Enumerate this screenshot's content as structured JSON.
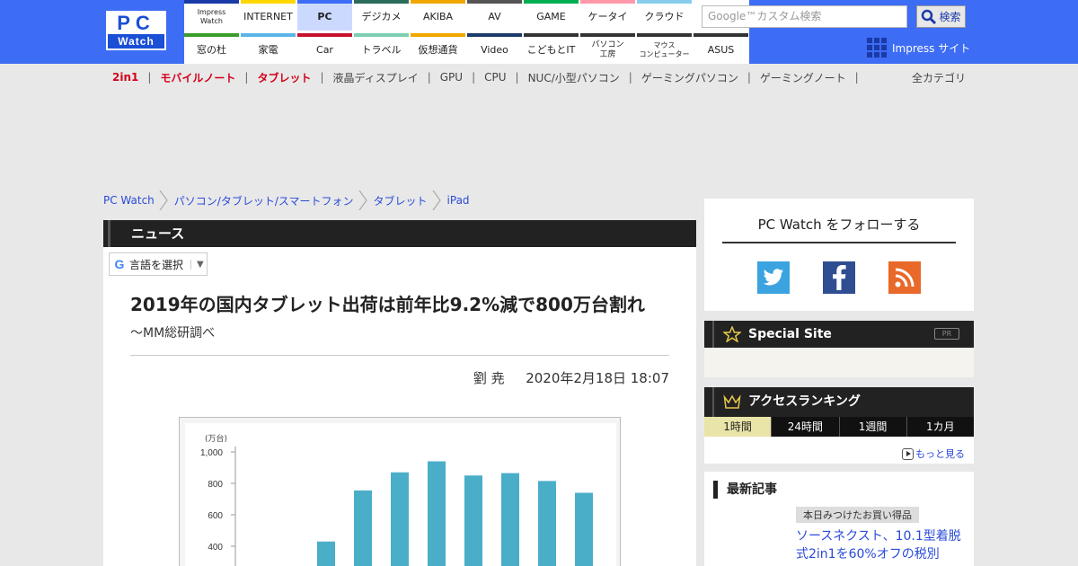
{
  "header": {
    "logo_top": "PC",
    "logo_bottom": "Watch",
    "nav_top": [
      {
        "label": "Impress\nWatch",
        "color": "#1a3aa8"
      },
      {
        "label": "INTERNET",
        "color": "#ffd700"
      },
      {
        "label": "PC",
        "color": "#3d6cf5",
        "active": true
      },
      {
        "label": "デジカメ",
        "color": "#2a6b5a"
      },
      {
        "label": "AKIBA",
        "color": "#f0a800"
      },
      {
        "label": "AV",
        "color": "#555555"
      },
      {
        "label": "GAME",
        "color": "#00b050"
      },
      {
        "label": "ケータイ",
        "color": "#ff99aa"
      },
      {
        "label": "クラウド",
        "color": "#88ccee"
      }
    ],
    "nav_bottom": [
      {
        "label": "窓の杜",
        "color": "#3a9c2a"
      },
      {
        "label": "家電",
        "color": "#5ab4e8"
      },
      {
        "label": "Car",
        "color": "#c8102e"
      },
      {
        "label": "トラベル",
        "color": "#7ccfb0"
      },
      {
        "label": "仮想通貨",
        "color": "#f0a800"
      },
      {
        "label": "Video",
        "color": "#1a3a6a"
      },
      {
        "label": "こどもとIT",
        "color": "#333333"
      },
      {
        "label": "パソコン\n工房",
        "color": "#333333"
      },
      {
        "label": "マウス\nコンピューター",
        "color": "#333333"
      },
      {
        "label": "ASUS",
        "color": "#333333"
      }
    ],
    "search_placeholder": "Google™カスタム検索",
    "search_button": "検索",
    "impress_site": "Impress サイト"
  },
  "subnav": {
    "items": [
      {
        "label": "2in1",
        "red": true
      },
      {
        "label": "モバイルノート",
        "red": true
      },
      {
        "label": "タブレット",
        "red": true
      },
      {
        "label": "液晶ディスプレイ",
        "red": false
      },
      {
        "label": "GPU",
        "red": false
      },
      {
        "label": "CPU",
        "red": false
      },
      {
        "label": "NUC/小型パソコン",
        "red": false
      },
      {
        "label": "ゲーミングパソコン",
        "red": false
      },
      {
        "label": "ゲーミングノート",
        "red": false
      }
    ],
    "all_categories": "全カテゴリ"
  },
  "breadcrumb": [
    "PC Watch",
    "パソコン/タブレット/スマートフォン",
    "タブレット",
    "iPad"
  ],
  "article": {
    "section": "ニュース",
    "translate_label": "言語を選択",
    "translate_arrow": "▼",
    "title": "2019年の国内タブレット出荷は前年比9.2%減で800万台割れ",
    "subtitle": "～MM総研調べ",
    "author": "劉 尭",
    "date": "2020年2月18日 18:07"
  },
  "chart_data": {
    "type": "bar",
    "unit_label": "(万台)",
    "yticks": [
      1000,
      800,
      600,
      400
    ],
    "ytick_labels": [
      "1,000",
      "800",
      "600",
      "400"
    ],
    "values": [
      430,
      755,
      870,
      940,
      850,
      865,
      815,
      740
    ],
    "color": "#4aaec9"
  },
  "sidebar": {
    "follow_title": "PC Watch をフォローする",
    "special_site": "Special Site",
    "pr": "PR",
    "ranking_title": "アクセスランキング",
    "ranking_tabs": [
      "1時間",
      "24時間",
      "1週間",
      "1カ月"
    ],
    "more": "もっと見る",
    "latest_title": "最新記事",
    "latest_tag": "本日みつけたお買い得品",
    "latest_link": "ソースネクスト、10.1型着脱式2in1を60%オフの税別"
  }
}
